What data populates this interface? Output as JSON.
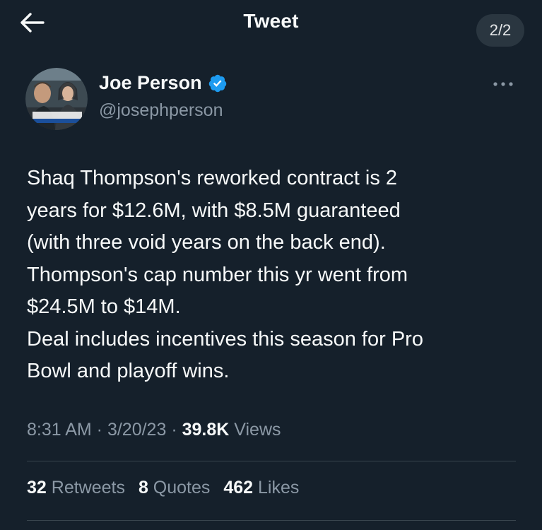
{
  "header": {
    "title": "Tweet",
    "page_indicator": "2/2"
  },
  "author": {
    "name": "Joe Person",
    "handle": "@josephperson",
    "verified": true
  },
  "tweet": {
    "lines": [
      "Shaq Thompson's reworked contract is 2",
      "years for $12.6M, with $8.5M guaranteed",
      "(with three void years on the back end).",
      "Thompson's cap number this yr went from",
      "$24.5M to $14M.",
      "Deal includes incentives this season for Pro",
      "Bowl and playoff wins."
    ]
  },
  "meta": {
    "time": "8:31 AM",
    "sep1": " · ",
    "date": "3/20/23",
    "sep2": " · ",
    "views_count": "39.8K",
    "views_label": " Views"
  },
  "stats": {
    "retweets_count": "32",
    "retweets_label": " Retweets",
    "quotes_count": "8",
    "quotes_label": " Quotes",
    "likes_count": "462",
    "likes_label": " Likes"
  },
  "icons": {
    "back": "arrow-left-icon",
    "verified": "verified-badge-icon",
    "more": "more-horizontal-icon"
  },
  "colors": {
    "background": "#15202b",
    "text_primary": "#f7f9f9",
    "text_secondary": "#8b98a5",
    "verified_blue": "#1d9bf0",
    "divider": "#38444d"
  }
}
